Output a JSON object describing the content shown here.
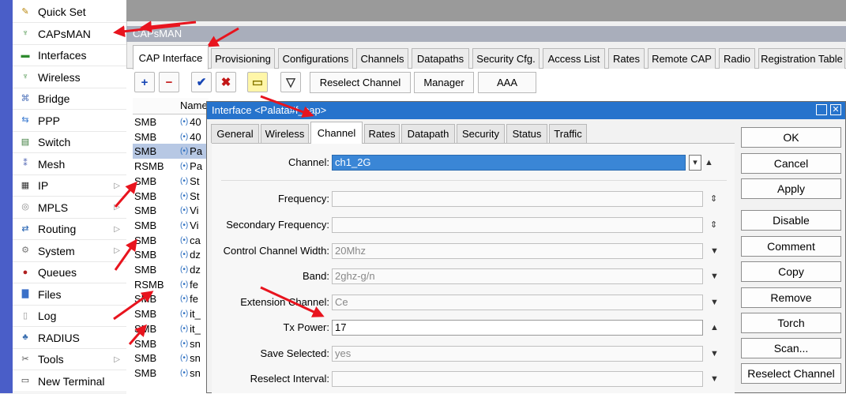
{
  "sidebar": {
    "items": [
      {
        "label": "Quick Set",
        "icon": "wand-icon",
        "submenu": false
      },
      {
        "label": "CAPsMAN",
        "icon": "antenna-icon",
        "submenu": false
      },
      {
        "label": "Interfaces",
        "icon": "interfaces-icon",
        "submenu": false
      },
      {
        "label": "Wireless",
        "icon": "antenna-icon",
        "submenu": false
      },
      {
        "label": "Bridge",
        "icon": "bridge-icon",
        "submenu": false
      },
      {
        "label": "PPP",
        "icon": "ppp-icon",
        "submenu": false
      },
      {
        "label": "Switch",
        "icon": "switch-icon",
        "submenu": false
      },
      {
        "label": "Mesh",
        "icon": "mesh-icon",
        "submenu": false
      },
      {
        "label": "IP",
        "icon": "ip-icon",
        "submenu": true
      },
      {
        "label": "MPLS",
        "icon": "mpls-icon",
        "submenu": true
      },
      {
        "label": "Routing",
        "icon": "routing-icon",
        "submenu": true
      },
      {
        "label": "System",
        "icon": "gear-icon",
        "submenu": true
      },
      {
        "label": "Queues",
        "icon": "queues-icon",
        "submenu": false
      },
      {
        "label": "Files",
        "icon": "folder-icon",
        "submenu": false
      },
      {
        "label": "Log",
        "icon": "log-icon",
        "submenu": false
      },
      {
        "label": "RADIUS",
        "icon": "radius-icon",
        "submenu": false
      },
      {
        "label": "Tools",
        "icon": "tools-icon",
        "submenu": true
      },
      {
        "label": "New Terminal",
        "icon": "terminal-icon",
        "submenu": false
      }
    ],
    "arrow_glyph": "▷"
  },
  "window": {
    "title": "CAPsMAN",
    "tabs": [
      "CAP Interface",
      "Provisioning",
      "Configurations",
      "Channels",
      "Datapaths",
      "Security Cfg.",
      "Access List",
      "Rates",
      "Remote CAP",
      "Radio",
      "Registration Table"
    ],
    "toolbar": {
      "add": "+",
      "remove": "−",
      "enable": "✔",
      "disable": "✖",
      "comment": "▭",
      "filter": "▽",
      "reselect_channel": "Reselect Channel",
      "manager": "Manager",
      "aaa": "AAA"
    },
    "list": {
      "name_header": "Name",
      "rows": [
        {
          "type": "SMB",
          "name": "40"
        },
        {
          "type": "SMB",
          "name": "40"
        },
        {
          "type": "SMB",
          "name": "Pa",
          "selected": true
        },
        {
          "type": "RSMB",
          "name": "Pa"
        },
        {
          "type": "SMB",
          "name": "St"
        },
        {
          "type": "SMB",
          "name": "St"
        },
        {
          "type": "SMB",
          "name": "Vi"
        },
        {
          "type": "SMB",
          "name": "Vi"
        },
        {
          "type": "SMB",
          "name": "ca"
        },
        {
          "type": "SMB",
          "name": "dz"
        },
        {
          "type": "SMB",
          "name": "dz"
        },
        {
          "type": "RSMB",
          "name": "fe"
        },
        {
          "type": "SMB",
          "name": "fe"
        },
        {
          "type": "SMB",
          "name": "it_"
        },
        {
          "type": "SMB",
          "name": "it_"
        },
        {
          "type": "SMB",
          "name": "sn"
        },
        {
          "type": "SMB",
          "name": "sn"
        },
        {
          "type": "SMB",
          "name": "sn"
        }
      ]
    }
  },
  "dialog": {
    "title": "Interface <Palata#f_cap>",
    "tabs": [
      "General",
      "Wireless",
      "Channel",
      "Rates",
      "Datapath",
      "Security",
      "Status",
      "Traffic"
    ],
    "active_tab": "Channel",
    "fields": {
      "channel": {
        "label": "Channel:",
        "value": "ch1_2G"
      },
      "frequency": {
        "label": "Frequency:",
        "value": ""
      },
      "secondary_frequency": {
        "label": "Secondary Frequency:",
        "value": ""
      },
      "control_channel_width": {
        "label": "Control Channel Width:",
        "value": "20Mhz"
      },
      "band": {
        "label": "Band:",
        "value": "2ghz-g/n"
      },
      "extension_channel": {
        "label": "Extension Channel:",
        "value": "Ce"
      },
      "tx_power": {
        "label": "Tx Power:",
        "value": "17"
      },
      "save_selected": {
        "label": "Save Selected:",
        "value": "yes"
      },
      "reselect_interval": {
        "label": "Reselect Interval:",
        "value": ""
      }
    },
    "buttons": {
      "ok": "OK",
      "cancel": "Cancel",
      "apply": "Apply",
      "disable": "Disable",
      "comment": "Comment",
      "copy": "Copy",
      "remove": "Remove",
      "torch": "Torch",
      "scan": "Scan...",
      "reselect_channel": "Reselect Channel"
    }
  },
  "colors": {
    "sidebar_strip": "#4a5ec8",
    "dialog_title": "#2673cc",
    "selection": "#3a86d6",
    "annotation_arrow": "#e8141e"
  }
}
